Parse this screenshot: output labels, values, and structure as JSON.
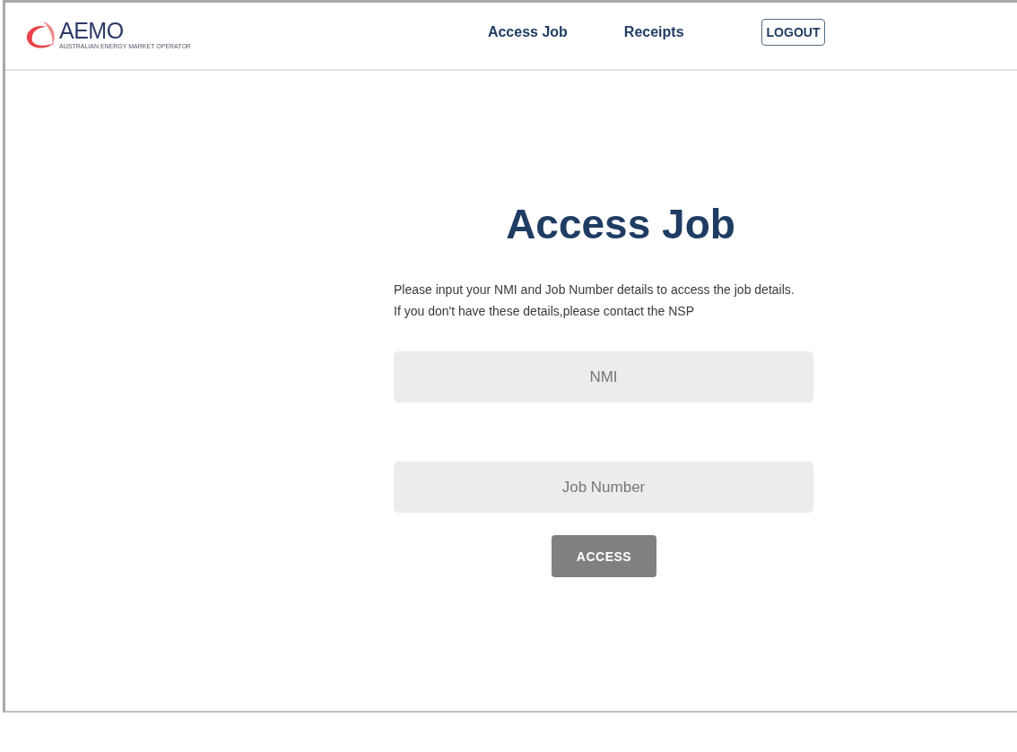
{
  "logo": {
    "name": "AEMO",
    "tagline": "AUSTRALIAN ENERGY MARKET OPERATOR"
  },
  "nav": {
    "links": [
      "Access Job",
      "Receipts"
    ],
    "logout": "LOGOUT"
  },
  "title": "Access Job",
  "intro": [
    "Please input your NMI and Job Number details to access the job details.",
    "If you don't have these details,please contact the NSP"
  ],
  "fields": [
    {
      "placeholder": "NMI"
    },
    {
      "placeholder": "Job Number"
    }
  ],
  "button": "ACCESS"
}
